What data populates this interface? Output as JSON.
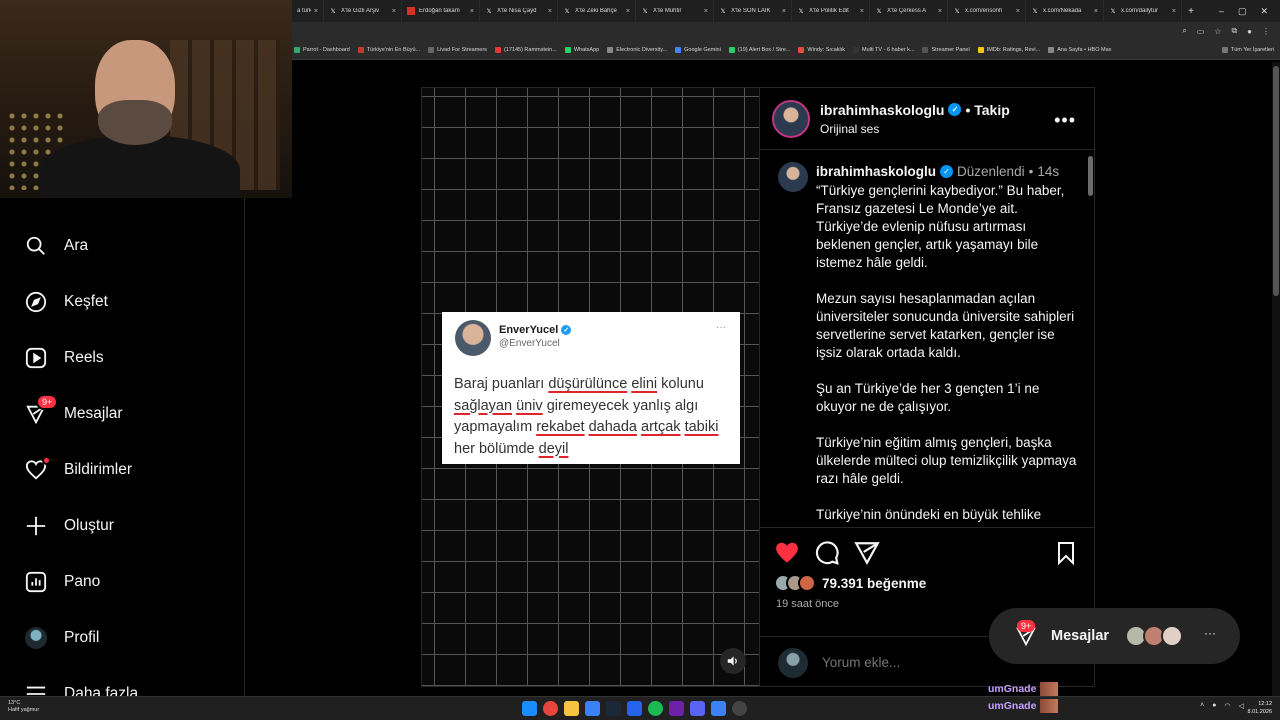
{
  "browser": {
    "tabs": [
      {
        "title": "a turk",
        "favicon": "x-icon"
      },
      {
        "title": "X'te Gizli Arşiv",
        "favicon": "x-icon"
      },
      {
        "title": "Erdoğan takam",
        "favicon": "red-icon"
      },
      {
        "title": "X'te Nisa Çayd",
        "favicon": "x-icon"
      },
      {
        "title": "X'te Zeki Bahçe",
        "favicon": "x-icon"
      },
      {
        "title": "X'te Muhtir",
        "favicon": "x-icon"
      },
      {
        "title": "X'te SON LAİK",
        "favicon": "x-icon"
      },
      {
        "title": "X'te Politik Edit",
        "favicon": "x-icon"
      },
      {
        "title": "X'te Çerkess A",
        "favicon": "x-icon"
      },
      {
        "title": "x.com/ensonh",
        "favicon": "x-icon"
      },
      {
        "title": "x.com/Nekada",
        "favicon": "x-icon"
      },
      {
        "title": "x.com/dailytur",
        "favicon": "x-icon"
      }
    ],
    "new_tab": "+",
    "bookmarks": [
      "Parrot - Dashboard",
      "Türkiye'nin En Büyü...",
      "Livad For Streamers",
      "(17145) Rammstein...",
      "WhatsApp",
      "Electronic Diversity...",
      "Google Gemini",
      "(19) Alert Box / Stre...",
      "Windy: Sıcaklık",
      "Multi TV - 6 haber k...",
      "Streamer Panel",
      "IMDb: Ratings, Revi...",
      "Ana Sayfa • HBO Max"
    ],
    "all_bookmarks": "Tüm Yer İşaretleri"
  },
  "sidebar": {
    "items": [
      {
        "label": "Ara",
        "icon": "search-icon"
      },
      {
        "label": "Keşfet",
        "icon": "compass-icon"
      },
      {
        "label": "Reels",
        "icon": "reels-icon"
      },
      {
        "label": "Mesajlar",
        "icon": "messenger-icon",
        "badge": "9+"
      },
      {
        "label": "Bildirimler",
        "icon": "heart-icon"
      },
      {
        "label": "Oluştur",
        "icon": "plus-icon"
      },
      {
        "label": "Pano",
        "icon": "dashboard-icon"
      },
      {
        "label": "Profil",
        "icon": "avatar"
      },
      {
        "label": "Daha fazla",
        "icon": "menu-icon"
      }
    ]
  },
  "post": {
    "tweet": {
      "name": "EnverYucel",
      "handle": "@EnverYucel",
      "text_parts": [
        {
          "t": "Baraj puanları ",
          "u": false
        },
        {
          "t": "düşürülünce",
          "u": true
        },
        {
          "t": " ",
          "u": false
        },
        {
          "t": "elini",
          "u": true
        },
        {
          "t": " kolunu ",
          "u": false
        },
        {
          "t": "sağlayan",
          "u": true
        },
        {
          "t": " ",
          "u": false
        },
        {
          "t": "üniv",
          "u": true
        },
        {
          "t": " giremeyecek yanlış algı yapmayalım ",
          "u": false
        },
        {
          "t": "rekabet",
          "u": true
        },
        {
          "t": " ",
          "u": false
        },
        {
          "t": "dahada",
          "u": true
        },
        {
          "t": " ",
          "u": false
        },
        {
          "t": "artçak",
          "u": true
        },
        {
          "t": " ",
          "u": false
        },
        {
          "t": "tabiki",
          "u": true
        },
        {
          "t": " her bölümde ",
          "u": false
        },
        {
          "t": "deyil",
          "u": true
        }
      ]
    },
    "author": {
      "username": "ibrahimhaskologlu",
      "follow": "• Takip",
      "audio": "Orijinal ses"
    },
    "caption": {
      "username": "ibrahimhaskologlu",
      "edited": "Düzenlendi",
      "dot": "•",
      "age": "14s",
      "text": "“Türkiye gençlerini kaybediyor.” Bu haber, Fransız gazetesi Le Monde’ye ait. Türkiye’de evlenip nüfusu artırması beklenen gençler, artık yaşamayı bile istemez hâle geldi.\n\nMezun sayısı hesaplanmadan açılan üniversiteler sonucunda üniversite sahipleri servetlerine servet katarken, gençler ise işsiz olarak ortada kaldı.\n\nŞu an Türkiye’de her 3 gençten 1’i ne okuyor ne de çalışıyor.\n\nTürkiye’nin eğitim almış gençleri, başka ülkelerde mülteci olup temizlikçilik yapmaya razı hâle geldi.\n\nTürkiye’nin önündeki en büyük tehlike"
    },
    "likes": "79.391 beğenme",
    "time": "19 saat önce",
    "comment_placeholder": "Yorum ekle..."
  },
  "messages_pill": {
    "label": "Mesajlar",
    "badge": "9+",
    "more": "···"
  },
  "stream_chat": [
    {
      "user": "umGnade"
    },
    {
      "user": "umGnade"
    }
  ],
  "taskbar": {
    "weather_temp": "13°C",
    "weather_desc": "Hafif yağmur",
    "time": "12:12",
    "date": "8.01.2026"
  },
  "colors": {
    "like_red": "#ff3040",
    "verified_blue": "#0095f6",
    "underline_red": "#e0242e"
  }
}
